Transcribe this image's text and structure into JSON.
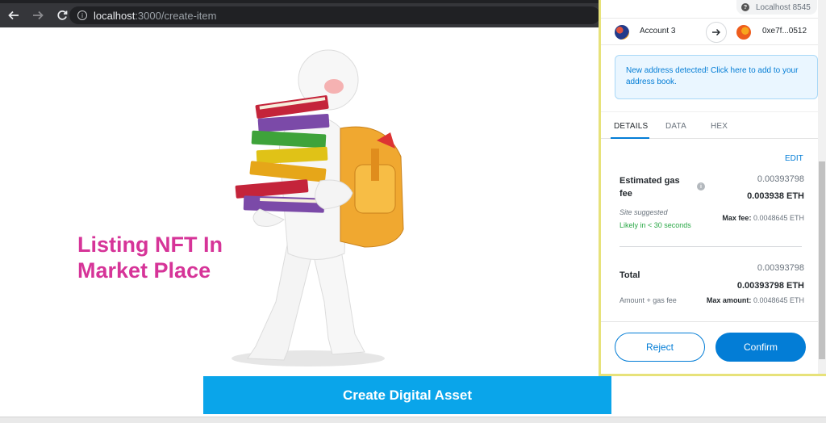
{
  "browser": {
    "url_host": "localhost",
    "url_path": ":3000/create-item"
  },
  "page": {
    "heading": "Listing NFT In Market Place",
    "create_button": "Create Digital Asset"
  },
  "metamask": {
    "network": "Localhost 8545",
    "from_account": "Account 3",
    "to_address": "0xe7f...0512",
    "notice": "New address detected! Click here to add to your address book.",
    "tabs": [
      "DETAILS",
      "DATA",
      "HEX"
    ],
    "active_tab": "DETAILS",
    "edit_label": "EDIT",
    "gas_fee_label": "Estimated gas fee",
    "gas_fee_value": "0.00393798",
    "gas_fee_eth": "0.003938 ETH",
    "site_suggested": "Site suggested",
    "likely_time": "Likely in < 30 seconds",
    "max_fee_label": "Max fee:",
    "max_fee_value": "0.0048645 ETH",
    "total_label": "Total",
    "total_value": "0.00393798",
    "total_eth": "0.00393798 ETH",
    "amount_gas_label": "Amount + gas fee",
    "max_amount_label": "Max amount:",
    "max_amount_value": "0.0048645 ETH",
    "reject_label": "Reject",
    "confirm_label": "Confirm"
  },
  "colors": {
    "heading": "#d63498",
    "cta": "#0aa5ea",
    "metamask_blue": "#037dd6",
    "likely_green": "#28a745",
    "popup_border": "#e7e27a"
  }
}
